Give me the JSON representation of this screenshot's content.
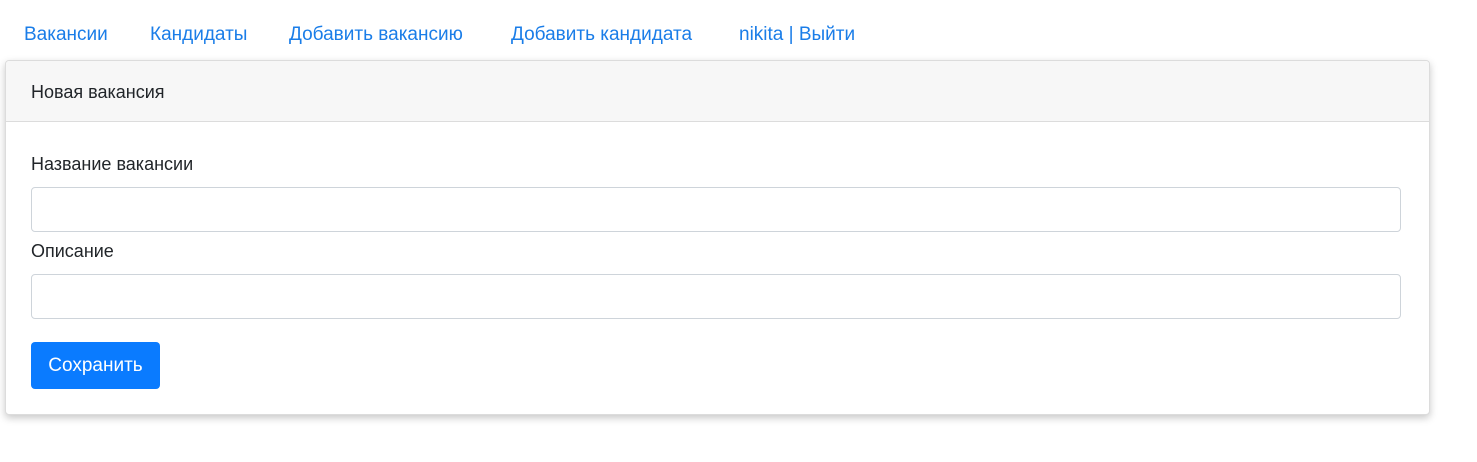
{
  "nav": {
    "items": [
      {
        "label": "Вакансии"
      },
      {
        "label": "Кандидаты"
      },
      {
        "label": "Добавить вакансию"
      },
      {
        "label": "Добавить кандидата"
      },
      {
        "label": "nikita | Выйти"
      }
    ]
  },
  "card": {
    "title": "Новая вакансия",
    "fields": [
      {
        "label": "Название вакансии",
        "value": "",
        "placeholder": ""
      },
      {
        "label": "Описание",
        "value": "",
        "placeholder": ""
      }
    ],
    "submit_label": "Сохранить"
  },
  "colors": {
    "link": "#1a7de8",
    "primary_button": "#0a7bff",
    "header_bg": "#f7f7f7"
  }
}
